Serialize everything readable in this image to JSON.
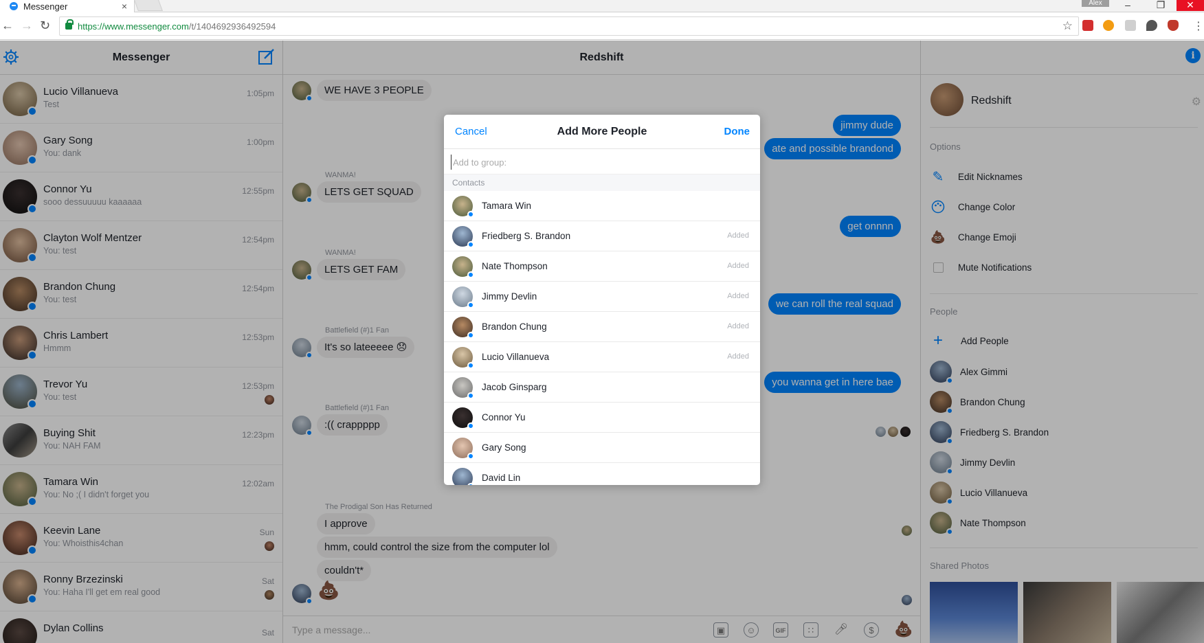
{
  "browser": {
    "tab_title": "Messenger",
    "tab_close": "×",
    "user_badge": "Alex",
    "url_host": "https://www.messenger.com",
    "url_path": "/t/1404692936492594",
    "win_min": "–",
    "win_max": "❐",
    "win_close": "✕"
  },
  "sidebar": {
    "title": "Messenger",
    "conversations": [
      {
        "name": "Lucio Villanueva",
        "snippet": "Test",
        "time": "1:05pm"
      },
      {
        "name": "Gary Song",
        "snippet": "You: dank",
        "time": "1:00pm"
      },
      {
        "name": "Connor Yu",
        "snippet": "sooo dessuuuuu kaaaaaa",
        "time": "12:55pm"
      },
      {
        "name": "Clayton Wolf Mentzer",
        "snippet": "You: test",
        "time": "12:54pm"
      },
      {
        "name": "Brandon Chung",
        "snippet": "You: test",
        "time": "12:54pm"
      },
      {
        "name": "Chris Lambert",
        "snippet": "Hmmm",
        "time": "12:53pm"
      },
      {
        "name": "Trevor Yu",
        "snippet": "You: test",
        "time": "12:53pm"
      },
      {
        "name": "Buying Shit",
        "snippet": "You: NAH FAM",
        "time": "12:23pm"
      },
      {
        "name": "Tamara Win",
        "snippet": "You: No ;( I didn't forget you",
        "time": "12:02am"
      },
      {
        "name": "Keevin Lane",
        "snippet": "You: Whoisthis4chan",
        "time": "Sun"
      },
      {
        "name": "Ronny Brzezinski",
        "snippet": "You: Haha I'll get em real good",
        "time": "Sat"
      },
      {
        "name": "Dylan Collins",
        "snippet": "",
        "time": "Sat"
      }
    ]
  },
  "thread": {
    "title": "Redshift",
    "messages_in": [
      {
        "sender": "",
        "text": "WE HAVE 3 PEOPLE"
      },
      {
        "sender": "WANMA!",
        "text": "LETS GET SQUAD"
      },
      {
        "sender": "WANMA!",
        "text": "LETS GET FAM"
      },
      {
        "sender": "Battlefield (#)1 Fan",
        "text": "It's so lateeeee 😞"
      },
      {
        "sender": "Battlefield (#)1 Fan",
        "text": ":(( crappppp"
      },
      {
        "sender": "The Prodigal Son Has Returned",
        "text": "I approve"
      },
      {
        "sender": "",
        "text": "hmm, could control the size from the computer lol"
      },
      {
        "sender": "",
        "text": "couldn't*"
      }
    ],
    "poop_emoji": "💩",
    "messages_out": [
      {
        "text": "jimmy dude"
      },
      {
        "text": "ate and possible brandond"
      },
      {
        "text": "get onnnn"
      },
      {
        "text": "we can roll the real squad"
      },
      {
        "text": "you wanna get in here bae"
      }
    ],
    "composer_placeholder": "Type a message...",
    "gif_label": "GIF",
    "dollar_label": "$"
  },
  "details": {
    "name": "Redshift",
    "options_header": "Options",
    "options": [
      {
        "label": "Edit Nicknames",
        "icon": "pencil-icon"
      },
      {
        "label": "Change Color",
        "icon": "palette-icon"
      },
      {
        "label": "Change Emoji",
        "icon": "poop-emoji-icon"
      },
      {
        "label": "Mute Notifications",
        "icon": "checkbox-icon"
      }
    ],
    "people_header": "People",
    "add_people": "Add People",
    "people": [
      "Alex Gimmi",
      "Brandon Chung",
      "Friedberg S. Brandon",
      "Jimmy Devlin",
      "Lucio Villanueva",
      "Nate Thompson"
    ],
    "shared_photos_header": "Shared Photos"
  },
  "modal": {
    "cancel": "Cancel",
    "title": "Add More People",
    "done": "Done",
    "input_placeholder": "Add to group:",
    "contacts_header": "Contacts",
    "contacts": [
      {
        "name": "Tamara Win",
        "added": ""
      },
      {
        "name": "Friedberg S. Brandon",
        "added": "Added"
      },
      {
        "name": "Nate Thompson",
        "added": "Added"
      },
      {
        "name": "Jimmy Devlin",
        "added": "Added"
      },
      {
        "name": "Brandon Chung",
        "added": "Added"
      },
      {
        "name": "Lucio Villanueva",
        "added": "Added"
      },
      {
        "name": "Jacob Ginsparg",
        "added": ""
      },
      {
        "name": "Connor Yu",
        "added": ""
      },
      {
        "name": "Gary Song",
        "added": ""
      },
      {
        "name": "David Lin",
        "added": ""
      }
    ]
  },
  "colors": {
    "messenger_blue": "#0084ff",
    "close_red": "#e81123",
    "secure_green": "#118a3f"
  }
}
